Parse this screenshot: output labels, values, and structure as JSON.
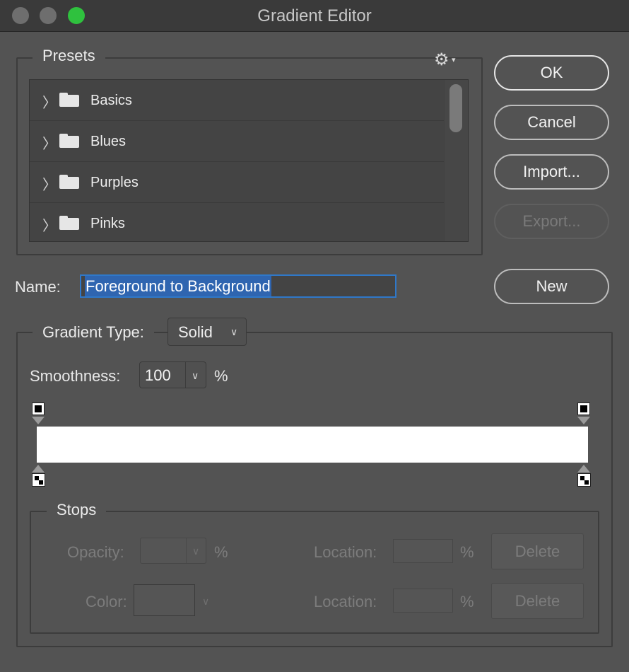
{
  "window": {
    "title": "Gradient Editor"
  },
  "presets": {
    "legend": "Presets",
    "settings_icon": "gear-icon",
    "folders": [
      {
        "label": "Basics"
      },
      {
        "label": "Blues"
      },
      {
        "label": "Purples"
      },
      {
        "label": "Pinks"
      }
    ]
  },
  "buttons": {
    "ok": "OK",
    "cancel": "Cancel",
    "import": "Import...",
    "export": "Export...",
    "new": "New"
  },
  "name": {
    "label": "Name:",
    "value": "Foreground to Background"
  },
  "gradient": {
    "type_label": "Gradient Type:",
    "type_value": "Solid",
    "smoothness_label": "Smoothness:",
    "smoothness_value": "100",
    "smoothness_unit": "%",
    "bar_color": "#ffffff"
  },
  "stops": {
    "legend": "Stops",
    "opacity_label": "Opacity:",
    "opacity_unit": "%",
    "location_label": "Location:",
    "location_unit": "%",
    "color_label": "Color:",
    "delete_label": "Delete"
  },
  "colors": {
    "accent": "#2f78c9",
    "window_bg": "#535353",
    "zoom_button": "#2fc13e"
  }
}
